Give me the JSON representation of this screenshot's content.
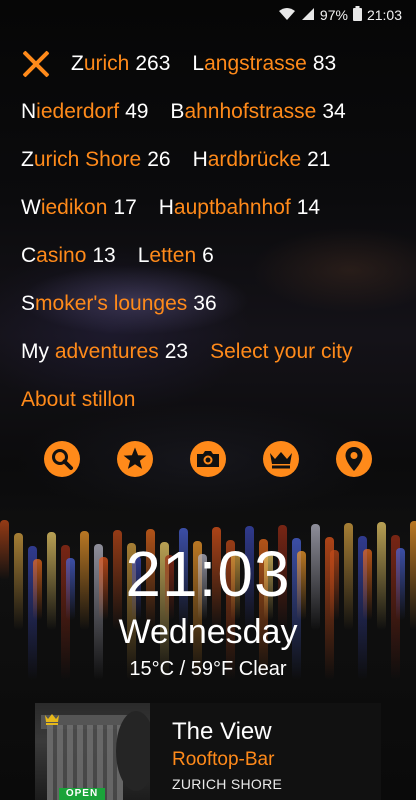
{
  "status_bar": {
    "battery": "97%",
    "time": "21:03"
  },
  "menu": {
    "rows": [
      [
        {
          "first": "Z",
          "rest": "urich",
          "count": "263"
        },
        {
          "first": "L",
          "rest": "angstrasse",
          "count": "83"
        }
      ],
      [
        {
          "first": "N",
          "rest": "iederdorf",
          "count": "49"
        },
        {
          "first": "B",
          "rest": "ahnhofstrasse",
          "count": "34"
        }
      ],
      [
        {
          "first": "Z",
          "rest": "urich Shore",
          "count": "26"
        },
        {
          "first": "H",
          "rest": "ardbrücke",
          "count": "21"
        }
      ],
      [
        {
          "first": "W",
          "rest": "iedikon",
          "count": "17"
        },
        {
          "first": "H",
          "rest": "auptbahnhof",
          "count": "14"
        }
      ],
      [
        {
          "first": "C",
          "rest": "asino",
          "count": "13"
        },
        {
          "first": "L",
          "rest": "etten",
          "count": "6"
        }
      ],
      [
        {
          "first": "S",
          "rest": "moker's lounges",
          "count": "36"
        }
      ],
      [
        {
          "first": "My ",
          "rest": "adventures",
          "count": "23"
        },
        {
          "first": "",
          "rest": "Select your city",
          "count": ""
        }
      ],
      [
        {
          "first": "",
          "rest": "About stillon",
          "count": ""
        }
      ]
    ]
  },
  "icons": [
    "search-icon",
    "star-icon",
    "camera-icon",
    "crown-icon",
    "location-pin-icon"
  ],
  "clock": {
    "time": "21:03",
    "day": "Wednesday",
    "weather": "15°C / 59°F Clear"
  },
  "card": {
    "name": "The View",
    "type": "Rooftop-Bar",
    "area": "ZURICH SHORE",
    "badge": "OPEN"
  },
  "colors": {
    "accent": "#ff8a1a",
    "text": "#ffffff"
  }
}
